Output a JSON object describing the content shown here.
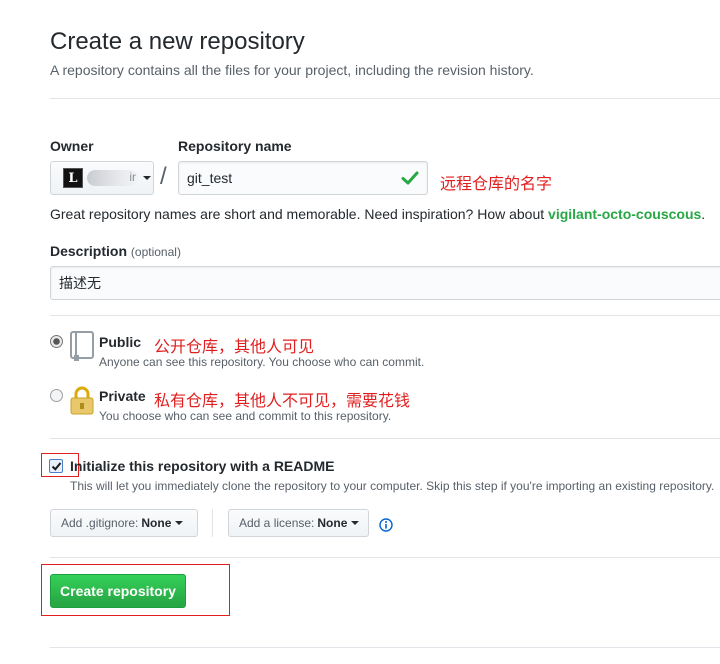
{
  "header": {
    "title": "Create a new repository",
    "subtitle": "A repository contains all the files for your project, including the revision history."
  },
  "owner": {
    "label": "Owner",
    "avatar_letter": "L",
    "name_partial": "ir"
  },
  "repo": {
    "label": "Repository name",
    "separator": "/",
    "value": "git_test",
    "annotation": "远程仓库的名字"
  },
  "hint": {
    "text": "Great repository names are short and memorable. Need inspiration? How about ",
    "suggestion": "vigilant-octo-couscous",
    "end": "."
  },
  "description": {
    "label": "Description",
    "optional": "(optional)",
    "value": "描述无"
  },
  "visibility": {
    "public": {
      "title": "Public",
      "desc": "Anyone can see this repository. You choose who can commit.",
      "annotation": "公开仓库，其他人可见",
      "checked": true
    },
    "private": {
      "title": "Private",
      "desc": "You choose who can see and commit to this repository.",
      "annotation": "私有仓库，其他人不可见，需要花钱",
      "checked": false
    }
  },
  "init": {
    "title": "Initialize this repository with a README",
    "desc": "This will let you immediately clone the repository to your computer. Skip this step if you're importing an existing repository.",
    "checked": true
  },
  "gitignore": {
    "prefix": "Add .gitignore:",
    "value": "None"
  },
  "license": {
    "prefix": "Add a license:",
    "value": "None"
  },
  "submit": {
    "label": "Create repository"
  },
  "colors": {
    "primary_button": "#28a745",
    "annotation_red": "#e02020",
    "suggestion_green": "#28a745"
  }
}
